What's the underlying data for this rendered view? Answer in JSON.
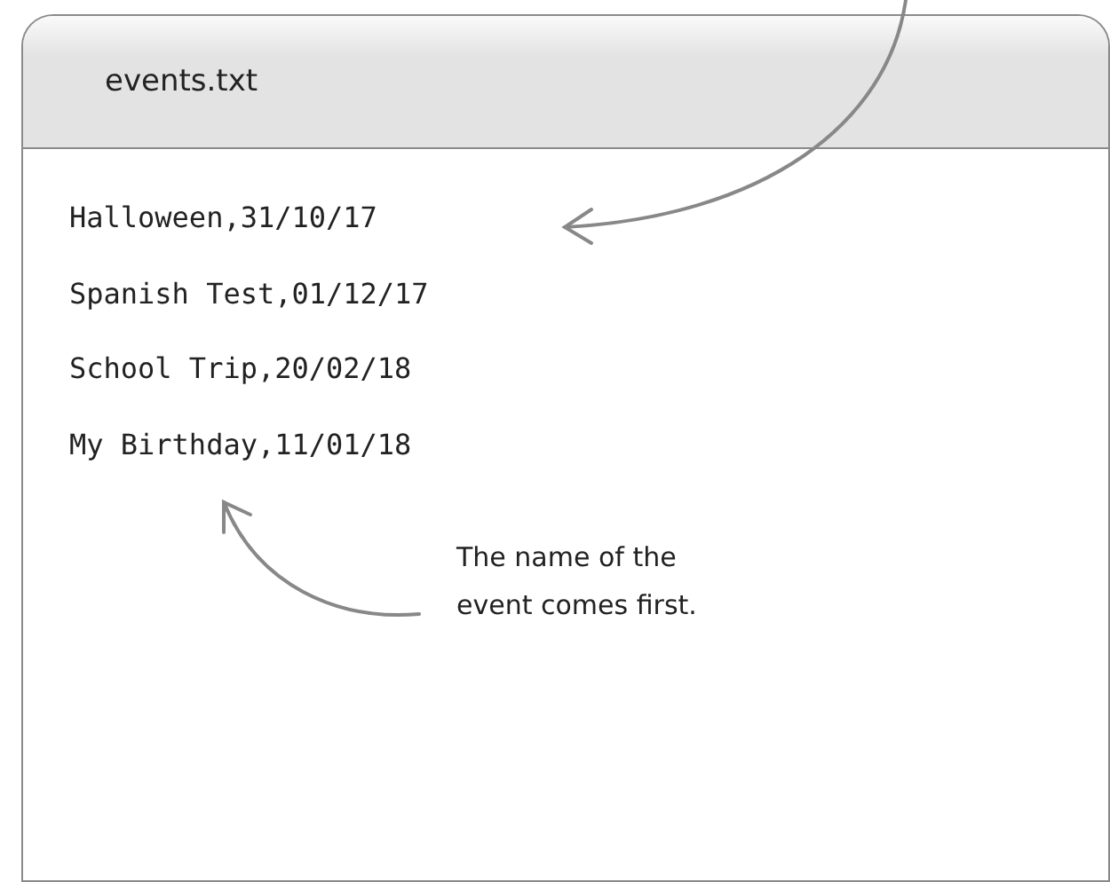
{
  "window": {
    "title": "events.txt"
  },
  "file_lines": [
    "Halloween,31/10/17",
    "Spanish Test,01/12/17",
    "School Trip,20/02/18",
    "My Birthday,11/01/18"
  ],
  "annotation": {
    "text": "The name of the event comes first."
  }
}
